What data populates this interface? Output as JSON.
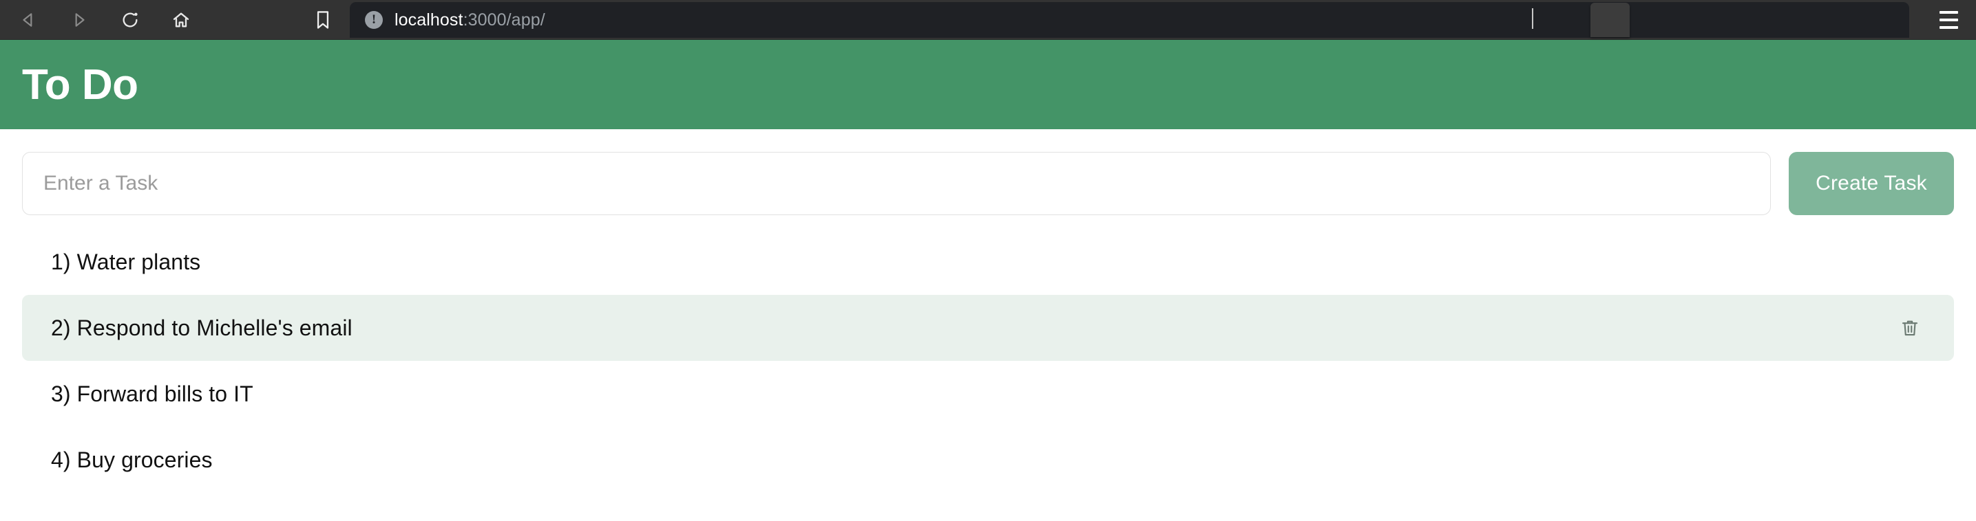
{
  "browser": {
    "back_icon": "back-arrow-icon",
    "forward_icon": "forward-arrow-icon",
    "reload_icon": "reload-icon",
    "home_icon": "home-icon",
    "bookmark_icon": "bookmark-icon",
    "site_info_icon": "site-info-warning-icon",
    "menu_icon": "hamburger-menu-icon",
    "url_host": "localhost",
    "url_rest": ":3000/app/",
    "url_full": "localhost:3000/app/",
    "toolbar_bg": "#333333",
    "urlbar_bg": "#1f2125"
  },
  "app": {
    "title": "To Do",
    "header_color": "#449467"
  },
  "composer": {
    "input_value": "",
    "input_placeholder": "Enter a Task",
    "create_label": "Create Task",
    "create_color": "#7fb69a"
  },
  "tasks": {
    "hover_color": "#e9f1ec",
    "delete_icon": "trash-icon",
    "items": [
      {
        "label": "1) Water plants",
        "hovered": false
      },
      {
        "label": "2) Respond to Michelle's email",
        "hovered": true
      },
      {
        "label": "3) Forward bills to IT",
        "hovered": false
      },
      {
        "label": "4) Buy groceries",
        "hovered": false
      }
    ]
  }
}
